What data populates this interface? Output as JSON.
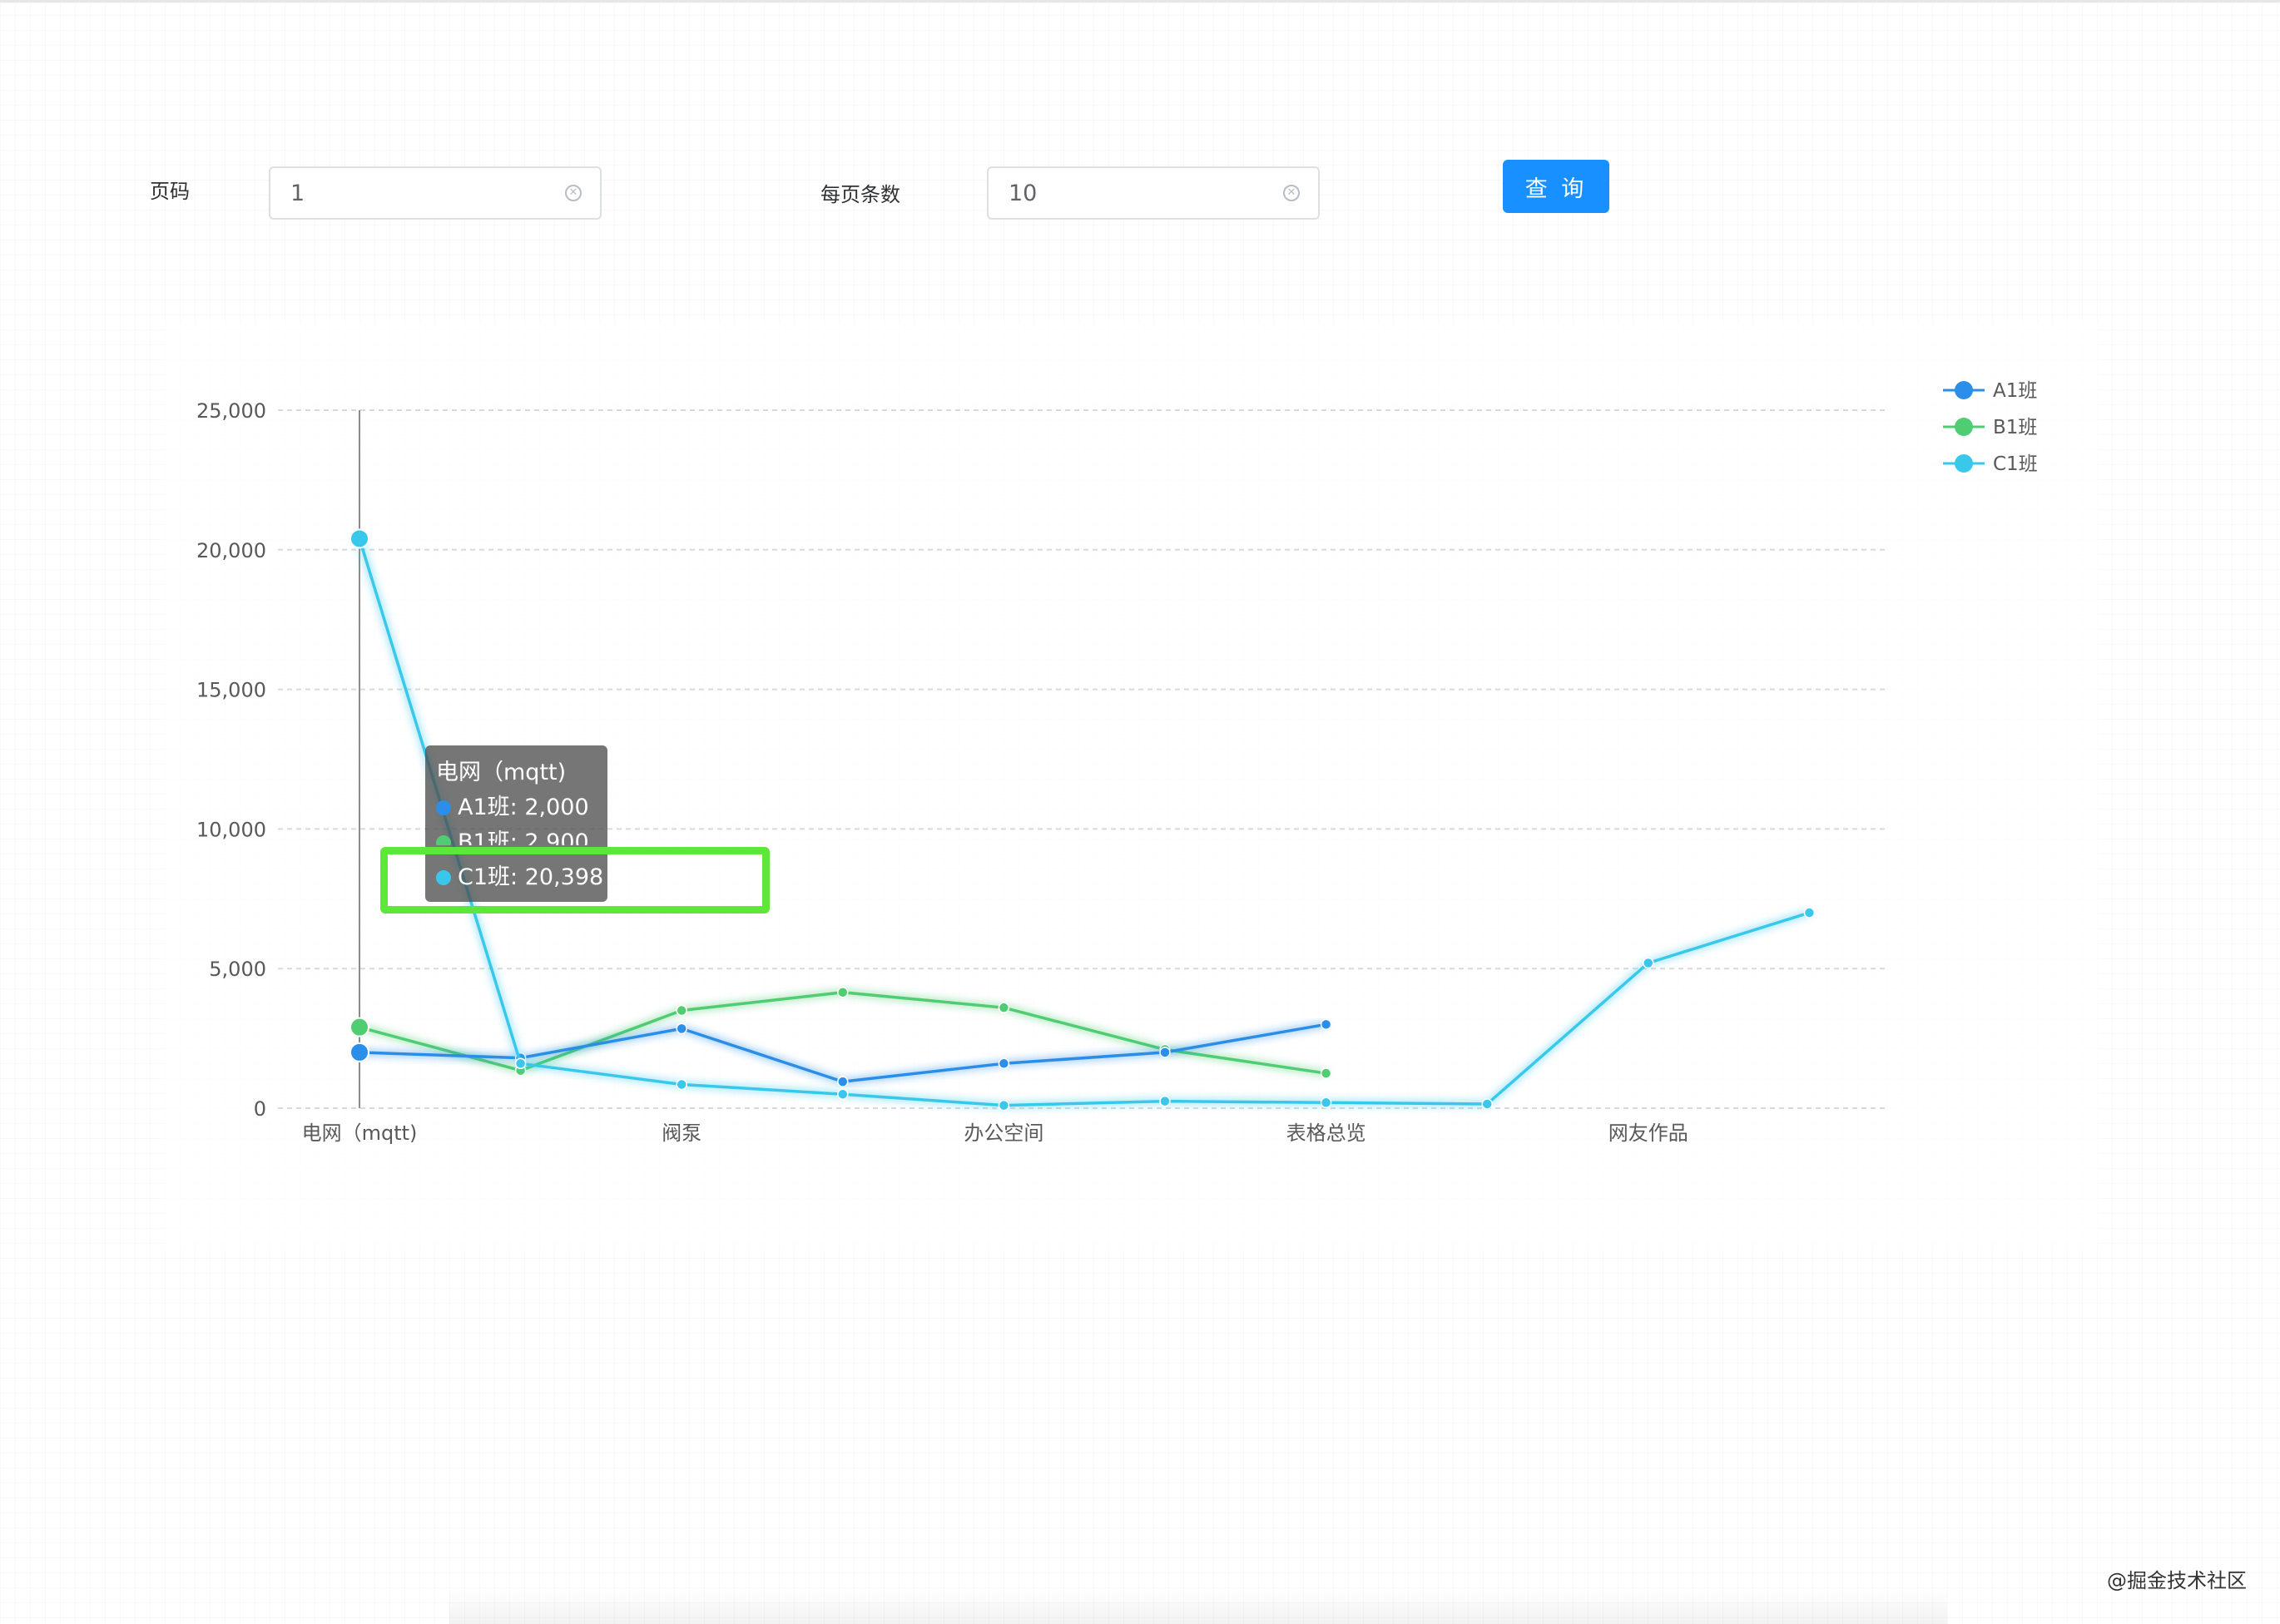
{
  "form": {
    "page_label": "页码",
    "page_value": "1",
    "page_size_label": "每页条数",
    "page_size_value": "10",
    "query_label": "查 询"
  },
  "chart_data": {
    "type": "line",
    "x": [
      "电网（mqtt)",
      "",
      "阀泵",
      "",
      "办公空间",
      "",
      "表格总览",
      "",
      "网友作品",
      ""
    ],
    "x_tick_labels": [
      "电网（mqtt)",
      "阀泵",
      "办公空间",
      "表格总览",
      "网友作品"
    ],
    "ylim": [
      0,
      25000
    ],
    "y_ticks": [
      0,
      5000,
      10000,
      15000,
      20000,
      25000
    ],
    "y_tick_labels": [
      "0",
      "5,000",
      "10,000",
      "15,000",
      "20,000",
      "25,000"
    ],
    "grid": true,
    "legend": "top-right",
    "series": [
      {
        "name": "A1班",
        "color": "#2b8ee8",
        "values": [
          2000,
          1800,
          2850,
          950,
          1600,
          2000,
          3000
        ]
      },
      {
        "name": "B1班",
        "color": "#4fcd72",
        "values": [
          2900,
          1350,
          3500,
          4150,
          3600,
          2100,
          1250
        ]
      },
      {
        "name": "C1班",
        "color": "#39c8ec",
        "values": [
          20398,
          1600,
          850,
          500,
          100,
          250,
          200,
          150,
          5200,
          7000
        ]
      }
    ],
    "tooltip": {
      "title": "电网（mqtt)",
      "rows": [
        {
          "label": "A1班: 2,000",
          "color": "#2b8ee8"
        },
        {
          "label": "B1班: 2,900",
          "color": "#4fcd72"
        },
        {
          "label": "C1班: 20,398",
          "color": "#39c8ec"
        }
      ]
    }
  },
  "watermark": "@掘金技术社区"
}
